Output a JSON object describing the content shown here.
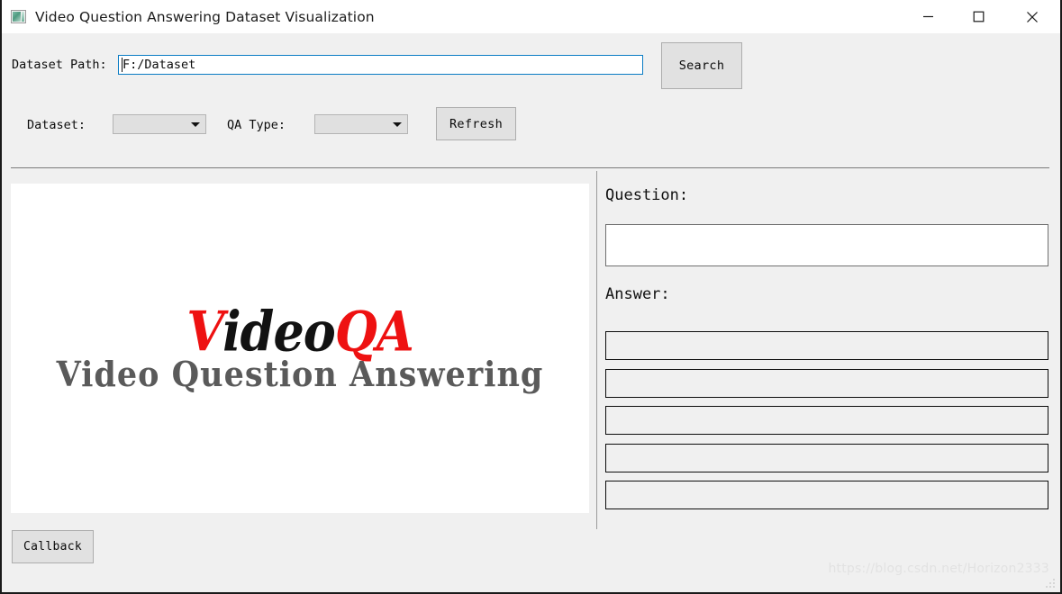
{
  "window": {
    "title": "Video Question Answering Dataset Visualization",
    "icon": "image-thumbnail-icon",
    "controls": {
      "minimize": "minimize-icon",
      "maximize": "maximize-icon",
      "close": "close-icon"
    }
  },
  "toolbar": {
    "dataset_path_label": "Dataset Path:",
    "dataset_path_value": "F:/Dataset",
    "dataset_path_placeholder": "",
    "search_label": "Search",
    "dataset_label": "Dataset:",
    "dataset_value": "",
    "qa_type_label": "QA Type:",
    "qa_type_value": "",
    "refresh_label": "Refresh"
  },
  "preview": {
    "logo_part_1": "V",
    "logo_part_2": "ideo",
    "logo_part_3": "QA",
    "logo_subtitle": "Video Question Answering"
  },
  "qa_panel": {
    "question_label": "Question:",
    "question_value": "",
    "answer_label": "Answer:",
    "answers": [
      "",
      "",
      "",
      "",
      ""
    ]
  },
  "footer": {
    "callback_label": "Callback",
    "watermark": "https://blog.csdn.net/Horizon2333"
  },
  "colors": {
    "window_bg": "#f0f0f0",
    "titlebar_bg": "#ffffff",
    "focus_border": "#0a7cc4",
    "logo_red": "#ee1111",
    "logo_black": "#121212",
    "logo_gray": "#5a5a5a"
  }
}
